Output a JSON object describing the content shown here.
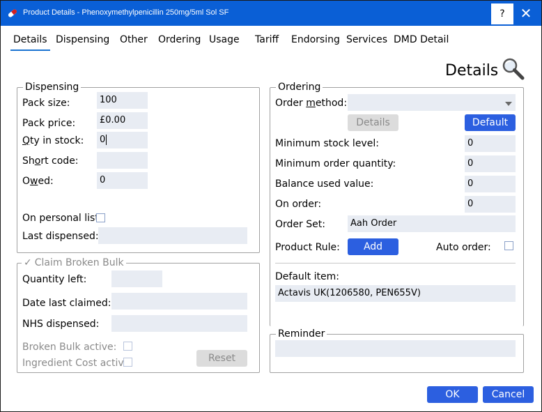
{
  "window": {
    "title": "Product Details - Phenoxymethylpenicillin 250mg/5ml Sol SF",
    "help_label": "?",
    "close_label": "✕"
  },
  "tabs": [
    {
      "label": "Details",
      "active": true
    },
    {
      "label": "Dispensing"
    },
    {
      "label": "Other"
    },
    {
      "label": "Ordering"
    },
    {
      "label": "Usage"
    },
    {
      "label": "Tariff"
    },
    {
      "label": "Endorsing"
    },
    {
      "label": "Services"
    },
    {
      "label": "DMD Detail"
    }
  ],
  "page_heading": "Details",
  "dispensing": {
    "title": "Dispensing",
    "pack_size_label": "Pack size:",
    "pack_size_value": "100",
    "pack_price_label": "Pack price:",
    "pack_price_value": "£0.00",
    "qty_label": "Qty in stock:",
    "qty_value": "0",
    "short_code_label": "Short code:",
    "short_code_value": "",
    "owed_label": "Owed:",
    "owed_value": "0",
    "personal_list_label": "On personal list:",
    "last_dispensed_label": "Last dispensed:",
    "last_dispensed_value": ""
  },
  "broken_bulk": {
    "title": "Claim Broken Bulk",
    "check_mark": "✓",
    "qty_left_label": "Quantity left:",
    "qty_left_value": "",
    "date_last_claimed_label": "Date last claimed:",
    "date_last_claimed_value": "",
    "nhs_dispensed_label": "NHS dispensed:",
    "nhs_dispensed_value": "",
    "broken_bulk_active_label": "Broken Bulk active:",
    "ingredient_cost_active_label": "Ingredient Cost active:",
    "reset_label": "Reset"
  },
  "ordering": {
    "title": "Ordering",
    "order_method_label": "Order method:",
    "order_method_value": "",
    "details_button": "Details",
    "default_button": "Default",
    "min_stock_label": "Minimum stock level:",
    "min_stock_value": "0",
    "min_order_label": "Minimum order quantity:",
    "min_order_value": "0",
    "balance_used_label": "Balance used value:",
    "balance_used_value": "0",
    "on_order_label": "On order:",
    "on_order_value": "0",
    "order_set_label": "Order Set:",
    "order_set_value": "Aah Order",
    "product_rule_label": "Product Rule:",
    "add_button": "Add",
    "auto_order_label": "Auto order:",
    "default_item_label": "Default item:",
    "default_item_value": "Actavis UK(1206580, PEN655V)"
  },
  "reminder": {
    "title": "Reminder",
    "value": ""
  },
  "footer": {
    "ok_label": "OK",
    "cancel_label": "Cancel"
  },
  "colors": {
    "titlebar": "#0a5fd6",
    "primary_button": "#2c5fe0",
    "field_bg": "#e8ecf3"
  }
}
